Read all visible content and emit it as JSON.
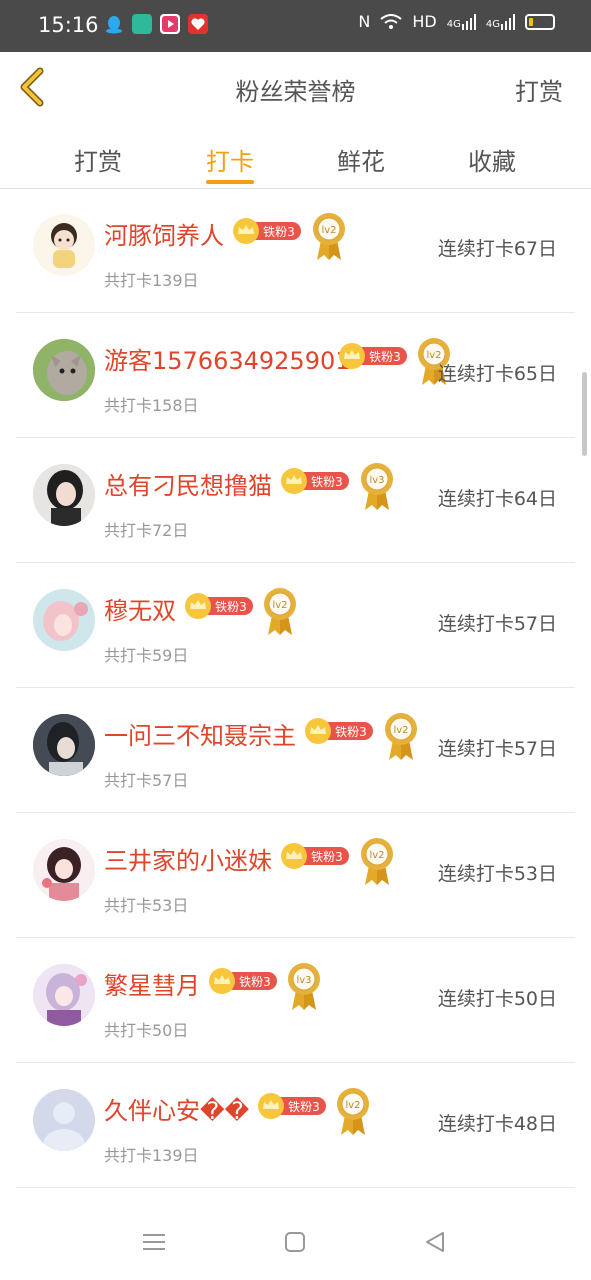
{
  "status_bar": {
    "time": "15:16",
    "network": "HD",
    "signal1": "4G",
    "signal2": "4G"
  },
  "header": {
    "title": "粉丝荣誉榜",
    "right_action": "打赏"
  },
  "tabs": [
    {
      "label": "打赏",
      "active": false
    },
    {
      "label": "打卡",
      "active": true
    },
    {
      "label": "鲜花",
      "active": false
    },
    {
      "label": "收藏",
      "active": false
    }
  ],
  "fans": [
    {
      "name": "河豚饲养人",
      "badge": "铁粉3",
      "level": "lv2",
      "total": "共打卡139日",
      "streak": "连续打卡67日"
    },
    {
      "name": "游客1576634925901",
      "badge": "铁粉3",
      "level": "lv2",
      "total": "共打卡158日",
      "streak": "连续打卡65日"
    },
    {
      "name": "总有刁民想撸猫",
      "badge": "铁粉3",
      "level": "lv3",
      "total": "共打卡72日",
      "streak": "连续打卡64日"
    },
    {
      "name": "穆无双",
      "badge": "铁粉3",
      "level": "lv2",
      "total": "共打卡59日",
      "streak": "连续打卡57日"
    },
    {
      "name": "一问三不知聂宗主",
      "badge": "铁粉3",
      "level": "lv2",
      "total": "共打卡57日",
      "streak": "连续打卡57日"
    },
    {
      "name": "三井家的小迷妹",
      "badge": "铁粉3",
      "level": "lv2",
      "total": "共打卡53日",
      "streak": "连续打卡53日"
    },
    {
      "name": "繁星彗月",
      "badge": "铁粉3",
      "level": "lv3",
      "total": "共打卡50日",
      "streak": "连续打卡50日"
    },
    {
      "name": "久伴心安��",
      "badge": "铁粉3",
      "level": "lv2",
      "total": "共打卡139日",
      "streak": "连续打卡48日"
    }
  ],
  "colors": {
    "accent": "#f0a010",
    "name": "#e0452b",
    "badge_bg": "#e8544a"
  }
}
